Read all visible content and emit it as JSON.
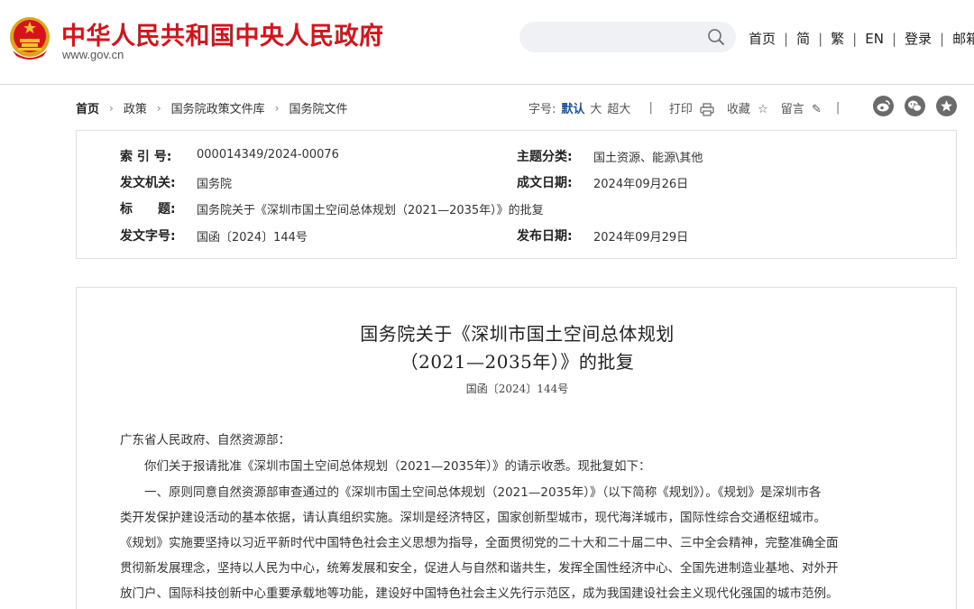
{
  "header": {
    "site_name": "中华人民共和国中央人民政府",
    "domain": "www.gov.cn",
    "search_placeholder": "",
    "nav": [
      "首页",
      "简",
      "繁",
      "EN",
      "登录",
      "邮箱"
    ],
    "nav_separator": "|"
  },
  "breadcrumb": [
    "首页",
    "政策",
    "国务院政策文件库",
    "国务院文件"
  ],
  "tools": {
    "font_size_label": "字号:",
    "font_sizes": [
      "默认",
      "大",
      "超大"
    ],
    "separator": "|",
    "print": "打印",
    "favorite": "收藏",
    "comment": "留言",
    "social_icons": [
      "weibo-icon",
      "wechat-icon",
      "star-icon"
    ]
  },
  "meta": {
    "index_no_label": "索 引 号:",
    "index_no": "000014349/2024-00076",
    "category_label": "主题分类:",
    "category": "国土资源、能源\\其他",
    "issuer_label": "发文机关:",
    "issuer": "国务院",
    "written_date_label": "成文日期:",
    "written_date": "2024年09月26日",
    "title_label": "标　　题:",
    "title": "国务院关于《深圳市国土空间总体规划（2021—2035年）》的批复",
    "doc_no_label": "发文字号:",
    "doc_no": "国函〔2024〕144号",
    "publish_date_label": "发布日期:",
    "publish_date": "2024年09月29日"
  },
  "article": {
    "title_line1": "国务院关于《深圳市国土空间总体规划",
    "title_line2": "（2021—2035年）》的批复",
    "doc_no": "国函〔2024〕144号",
    "paragraphs": [
      "广东省人民政府、自然资源部：",
      "　　你们关于报请批准《深圳市国土空间总体规划（2021—2035年）》的请示收悉。现批复如下：",
      "　　一、原则同意自然资源部审查通过的《深圳市国土空间总体规划（2021—2035年）》（以下简称《规划》）。《规划》是深圳市各",
      "类开发保护建设活动的基本依据，请认真组织实施。深圳是经济特区，国家创新型城市，现代海洋城市，国际性综合交通枢纽城市。",
      "《规划》实施要坚持以习近平新时代中国特色社会主义思想为指导，全面贯彻党的二十大和二十届二中、三中全会精神，完整准确全面",
      "贯彻新发展理念，坚持以人民为中心，统筹发展和安全，促进人与自然和谐共生，发挥全国性经济中心、全国先进制造业基地、对外开",
      "放门户、国际科技创新中心重要承载地等功能，建设好中国特色社会主义先行示范区，成为我国建设社会主义现代化强国的城市范例。"
    ]
  },
  "colors": {
    "brand_red": "#d6121b",
    "link_blue": "#1c53a5",
    "social_gray": "#6b6b6b"
  }
}
